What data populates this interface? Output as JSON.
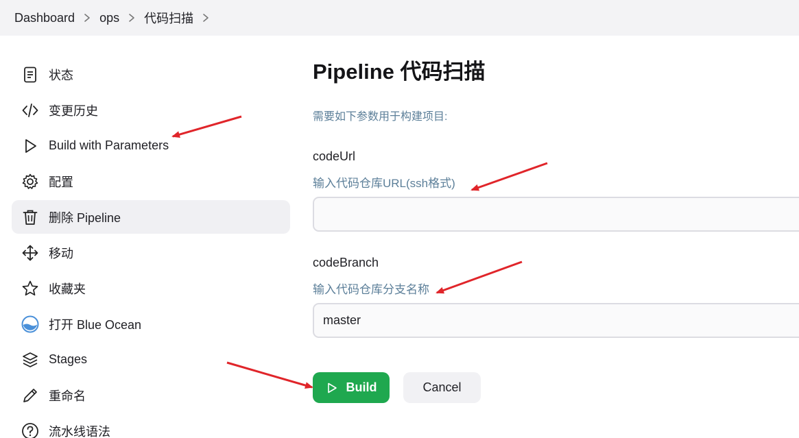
{
  "breadcrumb": [
    "Dashboard",
    "ops",
    "代码扫描"
  ],
  "sidebar": {
    "items": [
      {
        "label": "状态",
        "icon": "document-icon"
      },
      {
        "label": "变更历史",
        "icon": "code-icon"
      },
      {
        "label": "Build with Parameters",
        "icon": "play-icon"
      },
      {
        "label": "配置",
        "icon": "gear-icon"
      },
      {
        "label": "删除 Pipeline",
        "icon": "trash-icon",
        "active": true
      },
      {
        "label": "移动",
        "icon": "move-icon"
      },
      {
        "label": "收藏夹",
        "icon": "star-icon"
      },
      {
        "label": "打开 Blue Ocean",
        "icon": "blue-ocean-icon"
      },
      {
        "label": "Stages",
        "icon": "layers-icon"
      },
      {
        "label": "重命名",
        "icon": "pencil-icon"
      },
      {
        "label": "流水线语法",
        "icon": "help-icon"
      }
    ]
  },
  "main": {
    "title": "Pipeline 代码扫描",
    "intro": "需要如下参数用于构建项目:",
    "params": [
      {
        "name": "codeUrl",
        "description": "输入代码仓库URL(ssh格式)",
        "value": ""
      },
      {
        "name": "codeBranch",
        "description": "输入代码仓库分支名称",
        "value": "master"
      }
    ],
    "build_label": "Build",
    "cancel_label": "Cancel"
  },
  "colors": {
    "accent_green": "#1fa84f",
    "description_text": "#5c7f99",
    "annotation_arrow": "#e0252a",
    "breadcrumb_bg": "#f3f3f5"
  }
}
